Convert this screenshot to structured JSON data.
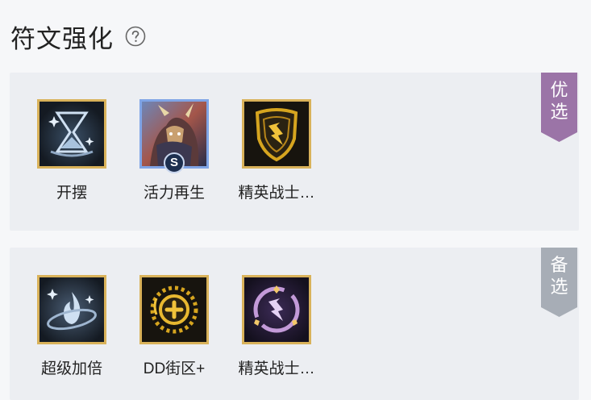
{
  "header": {
    "title": "符文强化",
    "help_icon": "question-circle-icon"
  },
  "sections": [
    {
      "ribbon": "优选",
      "ribbon_color": "#9b74a7",
      "cards": [
        {
          "label": "开摆",
          "icon": "hourglass-icon",
          "frame_color": "#d9b25a"
        },
        {
          "label": "活力再生",
          "icon": "champion-portrait-icon",
          "frame_color": "#7fa4e6",
          "badge": "S"
        },
        {
          "label": "精英战士…",
          "icon": "shield-emblem-icon",
          "frame_color": "#d9b25a"
        }
      ]
    },
    {
      "ribbon": "备选",
      "ribbon_color": "#a7adb6",
      "cards": [
        {
          "label": "超级加倍",
          "icon": "flame-orbit-icon",
          "frame_color": "#d9b25a"
        },
        {
          "label": "DD街区+",
          "icon": "coin-plus-icon",
          "frame_color": "#d9b25a"
        },
        {
          "label": "精英战士…",
          "icon": "crystal-ring-icon",
          "frame_color": "#d9b25a"
        }
      ]
    }
  ]
}
